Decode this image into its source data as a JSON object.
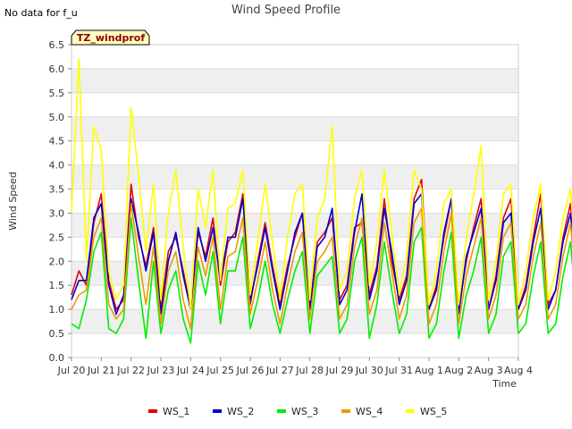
{
  "no_data_note": "No data for f_u",
  "badge_label": "TZ_windprof",
  "colors": {
    "band": "#efefef",
    "grid": "#dddddd",
    "badge_fill": "#ffffc0",
    "badge_text": "#8b0000"
  },
  "chart_data": {
    "type": "line",
    "title": "Wind Speed Profile",
    "xlabel": "Time",
    "ylabel": "Wind Speed",
    "ylim": [
      0,
      6.5
    ],
    "yticks": [
      "0.0",
      "0.5",
      "1.0",
      "1.5",
      "2.0",
      "2.5",
      "3.0",
      "3.5",
      "4.0",
      "4.5",
      "5.0",
      "5.5",
      "6.0",
      "6.5"
    ],
    "xlim": [
      "2023-07-20",
      "2023-08-04"
    ],
    "xticks": [
      "Jul 20",
      "Jul 21",
      "Jul 22",
      "Jul 23",
      "Jul 24",
      "Jul 25",
      "Jul 26",
      "Jul 27",
      "Jul 28",
      "Jul 29",
      "Jul 30",
      "Jul 31",
      "Aug 1",
      "Aug 2",
      "Aug 3",
      "Aug 4"
    ],
    "sampling": "6-hourly (00:00, 06:00, 12:00, 18:00) from 2023-07-20 00:00 to 2023-08-03 18:00",
    "grid": true,
    "legend_position": "bottom",
    "series": [
      {
        "name": "WS_1",
        "color": "#dd0000",
        "values": [
          1.3,
          1.8,
          1.5,
          2.8,
          3.4,
          1.6,
          1.0,
          1.2,
          3.6,
          2.5,
          1.9,
          2.7,
          1.0,
          2.2,
          2.5,
          1.8,
          1.0,
          2.6,
          2.1,
          2.9,
          1.5,
          2.4,
          2.6,
          3.4,
          1.1,
          2.0,
          2.8,
          1.9,
          1.1,
          1.9,
          2.5,
          3.0,
          1.0,
          2.4,
          2.6,
          2.9,
          1.2,
          1.5,
          2.7,
          2.8,
          1.3,
          1.9,
          3.3,
          2.0,
          1.2,
          1.7,
          3.3,
          3.7,
          1.0,
          1.5,
          2.5,
          3.3,
          1.0,
          2.0,
          2.7,
          3.3,
          1.0,
          1.7,
          2.9,
          3.3,
          1.0,
          1.5,
          2.5,
          3.4,
          1.1,
          1.4,
          2.5,
          3.2,
          1.2,
          1.6
        ]
      },
      {
        "name": "WS_2",
        "color": "#0000cc",
        "values": [
          1.2,
          1.6,
          1.6,
          2.9,
          3.2,
          1.5,
          0.9,
          1.3,
          3.3,
          2.6,
          1.8,
          2.6,
          0.9,
          2.0,
          2.6,
          1.7,
          1.0,
          2.7,
          2.0,
          2.7,
          1.6,
          2.5,
          2.5,
          3.3,
          1.2,
          1.9,
          2.7,
          1.8,
          1.0,
          1.8,
          2.6,
          3.0,
          1.0,
          2.3,
          2.5,
          3.1,
          1.1,
          1.4,
          2.6,
          3.4,
          1.2,
          1.8,
          3.1,
          2.2,
          1.1,
          1.6,
          3.2,
          3.4,
          1.0,
          1.4,
          2.6,
          3.3,
          0.9,
          2.1,
          2.6,
          3.1,
          1.0,
          1.6,
          2.8,
          3.0,
          1.0,
          1.4,
          2.4,
          3.1,
          1.0,
          1.4,
          2.4,
          3.0,
          1.2,
          1.6
        ]
      },
      {
        "name": "WS_3",
        "color": "#00ee00",
        "values": [
          0.7,
          0.6,
          1.2,
          2.2,
          2.6,
          0.6,
          0.5,
          0.8,
          2.9,
          1.6,
          0.4,
          2.0,
          0.5,
          1.4,
          1.8,
          0.8,
          0.3,
          2.0,
          1.3,
          2.2,
          0.7,
          1.8,
          1.8,
          2.5,
          0.6,
          1.2,
          2.0,
          1.1,
          0.5,
          1.2,
          1.8,
          2.2,
          0.5,
          1.7,
          1.9,
          2.1,
          0.5,
          0.8,
          2.0,
          2.5,
          0.4,
          1.1,
          2.4,
          1.4,
          0.5,
          0.9,
          2.4,
          2.7,
          0.4,
          0.7,
          1.8,
          2.6,
          0.4,
          1.3,
          1.8,
          2.5,
          0.5,
          0.9,
          2.1,
          2.4,
          0.5,
          0.7,
          1.7,
          2.4,
          0.5,
          0.7,
          1.7,
          2.4,
          0.6,
          0.7
        ]
      },
      {
        "name": "WS_4",
        "color": "#ee9900",
        "values": [
          1.0,
          1.3,
          1.4,
          2.5,
          2.9,
          1.1,
          0.8,
          1.0,
          3.2,
          2.1,
          1.1,
          2.3,
          0.7,
          1.8,
          2.2,
          1.2,
          0.6,
          2.3,
          1.7,
          2.5,
          1.0,
          2.1,
          2.2,
          2.9,
          0.9,
          1.6,
          2.4,
          1.4,
          0.7,
          1.5,
          2.2,
          2.6,
          0.8,
          2.0,
          2.2,
          2.5,
          0.8,
          1.1,
          2.3,
          2.9,
          0.9,
          1.4,
          2.8,
          1.8,
          0.8,
          1.3,
          2.8,
          3.1,
          0.7,
          1.1,
          2.2,
          3.0,
          0.7,
          1.7,
          2.3,
          2.9,
          0.8,
          1.3,
          2.5,
          2.8,
          0.8,
          1.1,
          2.1,
          2.8,
          0.8,
          1.1,
          2.1,
          2.8,
          0.9,
          1.2
        ]
      },
      {
        "name": "WS_5",
        "color": "#ffff00",
        "values": [
          3.0,
          6.2,
          2.0,
          4.8,
          4.3,
          1.8,
          1.2,
          1.5,
          5.2,
          3.8,
          2.2,
          3.6,
          1.2,
          3.0,
          3.9,
          2.3,
          1.0,
          3.5,
          2.7,
          3.9,
          1.6,
          3.1,
          3.2,
          3.9,
          1.3,
          2.4,
          3.6,
          2.4,
          1.2,
          2.5,
          3.4,
          3.6,
          1.2,
          2.9,
          3.3,
          4.8,
          1.4,
          1.8,
          3.3,
          3.9,
          1.5,
          2.4,
          3.9,
          2.6,
          1.3,
          2.1,
          3.9,
          3.5,
          1.1,
          1.8,
          3.2,
          3.5,
          1.1,
          2.5,
          3.4,
          4.4,
          1.2,
          2.0,
          3.4,
          3.6,
          1.1,
          1.8,
          2.9,
          3.6,
          1.2,
          1.8,
          2.9,
          3.5,
          1.3,
          1.9
        ]
      }
    ]
  }
}
